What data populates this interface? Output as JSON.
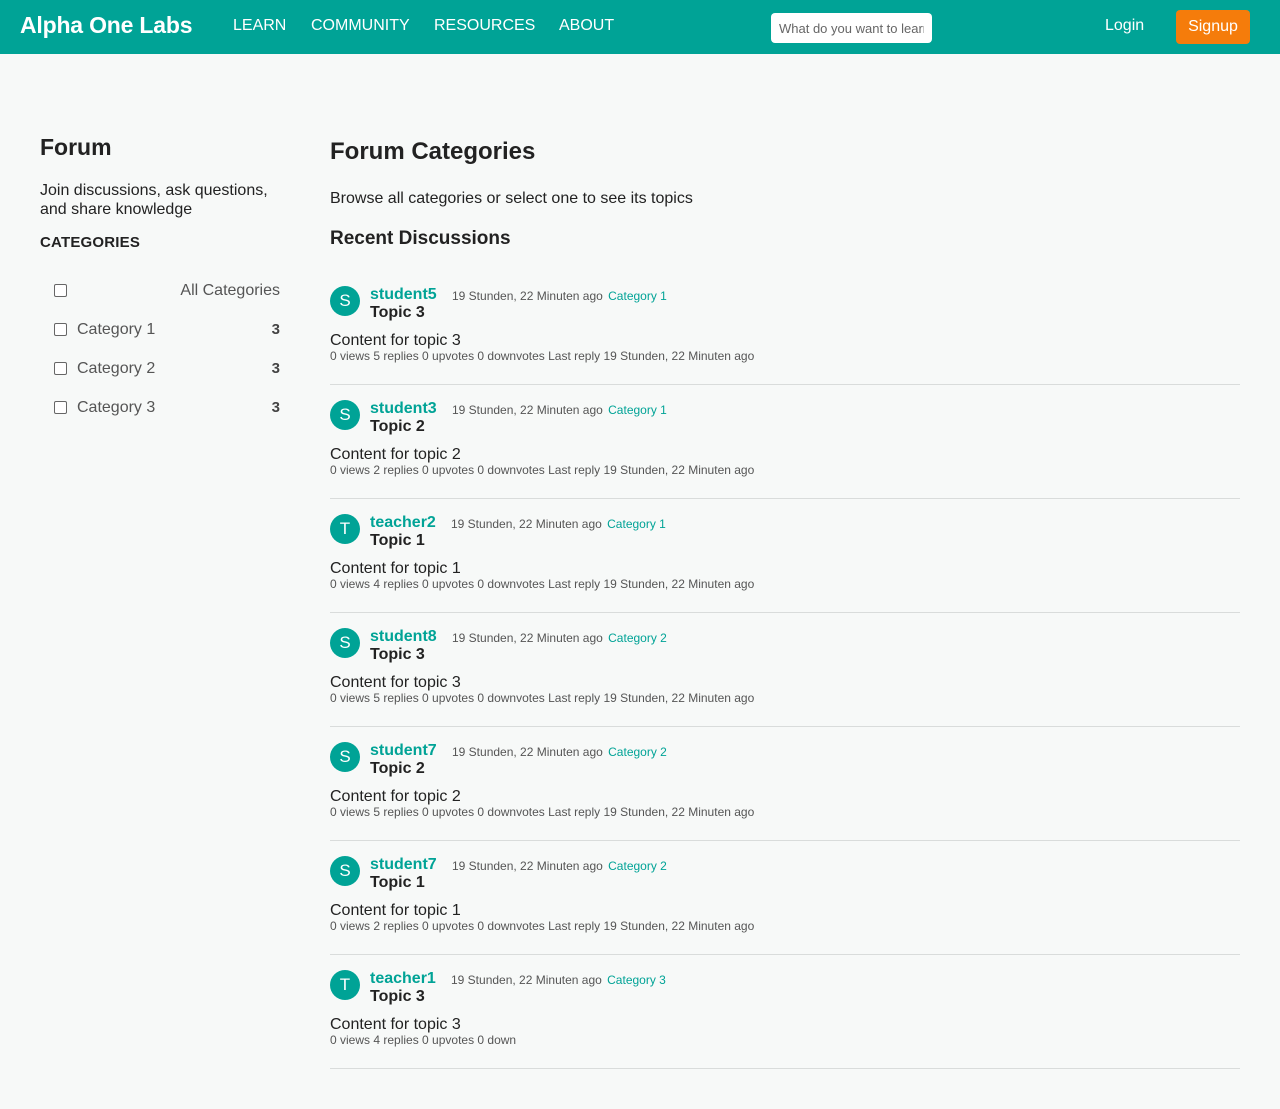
{
  "nav": {
    "brand": "Alpha One Labs",
    "links": [
      "LEARN",
      "COMMUNITY",
      "RESOURCES",
      "ABOUT"
    ],
    "search_placeholder": "What do you want to learn?",
    "login": "Login",
    "signup": "Signup"
  },
  "colors": {
    "brand": "#00a396",
    "signup": "#f57c0b"
  },
  "sidebar": {
    "title": "Forum",
    "description": "Join discussions, ask questions, and share knowledge",
    "categories_heading": "CATEGORIES",
    "all_label": "All Categories",
    "categories": [
      {
        "label": "Category 1",
        "count": "3"
      },
      {
        "label": "Category 2",
        "count": "3"
      },
      {
        "label": "Category 3",
        "count": "3"
      }
    ]
  },
  "main": {
    "title": "Forum Categories",
    "subtitle": "Browse all categories or select one to see its topics",
    "recent_heading": "Recent Discussions",
    "topics": [
      {
        "initial": "S",
        "author": "student5",
        "time": "19 Stunden, 22 Minuten ago",
        "category": "Category 1",
        "title": "Topic 3",
        "content": "Content for topic 3",
        "stats": "0 views 5 replies 0 upvotes 0 downvotes Last reply 19 Stunden, 22 Minuten ago"
      },
      {
        "initial": "S",
        "author": "student3",
        "time": "19 Stunden, 22 Minuten ago",
        "category": "Category 1",
        "title": "Topic 2",
        "content": "Content for topic 2",
        "stats": "0 views 2 replies 0 upvotes 0 downvotes Last reply 19 Stunden, 22 Minuten ago"
      },
      {
        "initial": "T",
        "author": "teacher2",
        "time": "19 Stunden, 22 Minuten ago",
        "category": "Category 1",
        "title": "Topic 1",
        "content": "Content for topic 1",
        "stats": "0 views 4 replies 0 upvotes 0 downvotes Last reply 19 Stunden, 22 Minuten ago"
      },
      {
        "initial": "S",
        "author": "student8",
        "time": "19 Stunden, 22 Minuten ago",
        "category": "Category 2",
        "title": "Topic 3",
        "content": "Content for topic 3",
        "stats": "0 views 5 replies 0 upvotes 0 downvotes Last reply 19 Stunden, 22 Minuten ago"
      },
      {
        "initial": "S",
        "author": "student7",
        "time": "19 Stunden, 22 Minuten ago",
        "category": "Category 2",
        "title": "Topic 2",
        "content": "Content for topic 2",
        "stats": "0 views 5 replies 0 upvotes 0 downvotes Last reply 19 Stunden, 22 Minuten ago"
      },
      {
        "initial": "S",
        "author": "student7",
        "time": "19 Stunden, 22 Minuten ago",
        "category": "Category 2",
        "title": "Topic 1",
        "content": "Content for topic 1",
        "stats": "0 views 2 replies 0 upvotes 0 downvotes Last reply 19 Stunden, 22 Minuten ago"
      },
      {
        "initial": "T",
        "author": "teacher1",
        "time": "19 Stunden, 22 Minuten ago",
        "category": "Category 3",
        "title": "Topic 3",
        "content": "Content for topic 3",
        "stats": "0 views 4 replies 0 upvotes 0 down"
      }
    ]
  }
}
